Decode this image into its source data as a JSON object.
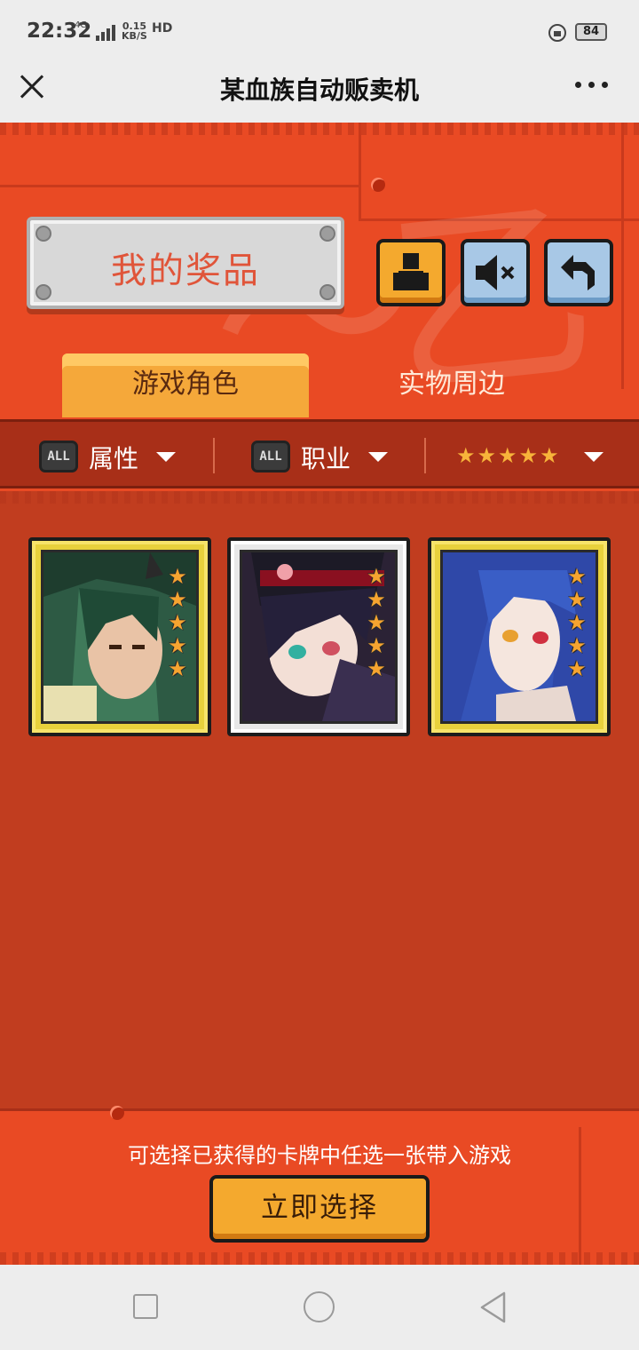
{
  "status_bar": {
    "time": "22:32",
    "network": "4G",
    "speed_value": "0.15",
    "speed_unit": "KB/S",
    "hd": "HD",
    "battery": "84"
  },
  "title_bar": {
    "title": "某血族自动贩卖机"
  },
  "header": {
    "prize_title": "我的奖品"
  },
  "tabs": [
    {
      "label": "游戏角色",
      "active": true
    },
    {
      "label": "实物周边",
      "active": false
    }
  ],
  "filters": {
    "all_badge": "ALL",
    "attribute_label": "属性",
    "profession_label": "职业",
    "stars": "★★★★★"
  },
  "cards": [
    {
      "frame": "gold",
      "stars": 5
    },
    {
      "frame": "silver",
      "stars": 5
    },
    {
      "frame": "gold",
      "stars": 5
    }
  ],
  "footer": {
    "hint": "可选择已获得的卡牌中任选一张带入游戏",
    "select_button": "立即选择"
  },
  "colors": {
    "background": "#e94a24",
    "card_area": "#c13d1f",
    "button_orange": "#f4a92e",
    "button_blue": "#a8c8e6"
  }
}
